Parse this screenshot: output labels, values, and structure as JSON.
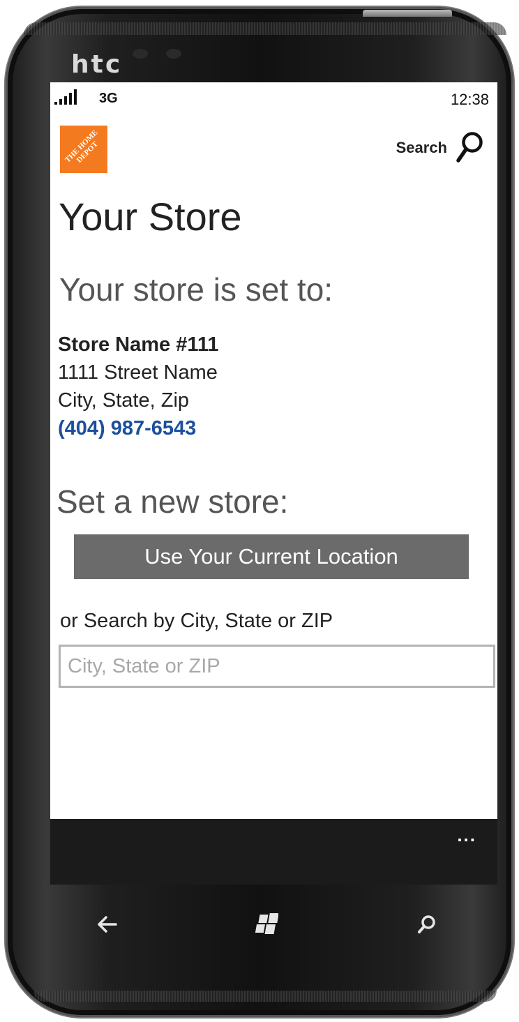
{
  "device": {
    "brand": "htc"
  },
  "status_bar": {
    "network": "3G",
    "time": "12:38",
    "signal_icon": "signal-bars-icon"
  },
  "header": {
    "logo_text": "THE HOME DEPOT",
    "search_label": "Search",
    "search_icon": "search-icon"
  },
  "page": {
    "title": "Your Store"
  },
  "current_store": {
    "heading": "Your store is set to:",
    "name": "Store Name #111",
    "street": "1111 Street Name",
    "city_state_zip": "City, State, Zip",
    "phone": "(404) 987-6543"
  },
  "new_store": {
    "heading": "Set a new store:",
    "location_button": "Use Your Current Location",
    "or_search_label": "or Search by City, State or ZIP",
    "search_placeholder": "City, State or ZIP",
    "search_value": ""
  },
  "app_bar": {
    "more_label": "..."
  },
  "hardware_buttons": [
    "back-arrow-icon",
    "windows-start-icon",
    "search-icon"
  ],
  "colors": {
    "brand_orange": "#f47a20",
    "phone_link": "#1c4f9c",
    "button_gray": "#6b6b6b",
    "app_bar": "#1b1b1b"
  }
}
